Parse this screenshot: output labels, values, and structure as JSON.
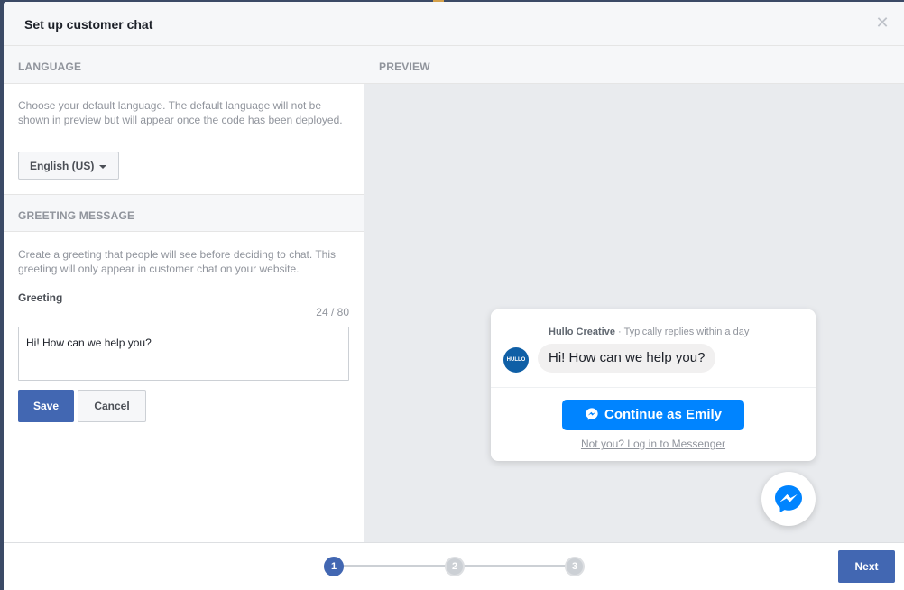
{
  "dialog": {
    "title": "Set up customer chat",
    "close_icon": "close-icon"
  },
  "language": {
    "header": "LANGUAGE",
    "description": "Choose your default language. The default language will not be shown in preview but will appear once the code has been deployed.",
    "selected": "English (US)"
  },
  "greeting": {
    "header": "GREETING MESSAGE",
    "description": "Create a greeting that people will see before deciding to chat. This greeting will only appear in customer chat on your website.",
    "label": "Greeting",
    "counter": "24 / 80",
    "value": "Hi! How can we help you?",
    "save_label": "Save",
    "cancel_label": "Cancel"
  },
  "preview": {
    "header": "PREVIEW",
    "page_name": "Hullo Creative",
    "reply_time": "Typically replies within a day",
    "separator": "·",
    "avatar_text": "HULLO",
    "bubble_text": "Hi! How can we help you?",
    "continue_label": "Continue as Emily",
    "not_you_label": "Not you? Log in to Messenger",
    "messenger_icon": "messenger-icon"
  },
  "footer": {
    "steps": [
      "1",
      "2",
      "3"
    ],
    "active_step": 1,
    "next_label": "Next"
  },
  "colors": {
    "primary": "#4267b2",
    "messenger_blue": "#0084ff",
    "panel_bg": "#f6f7f9",
    "preview_bg": "#e9ebee"
  }
}
